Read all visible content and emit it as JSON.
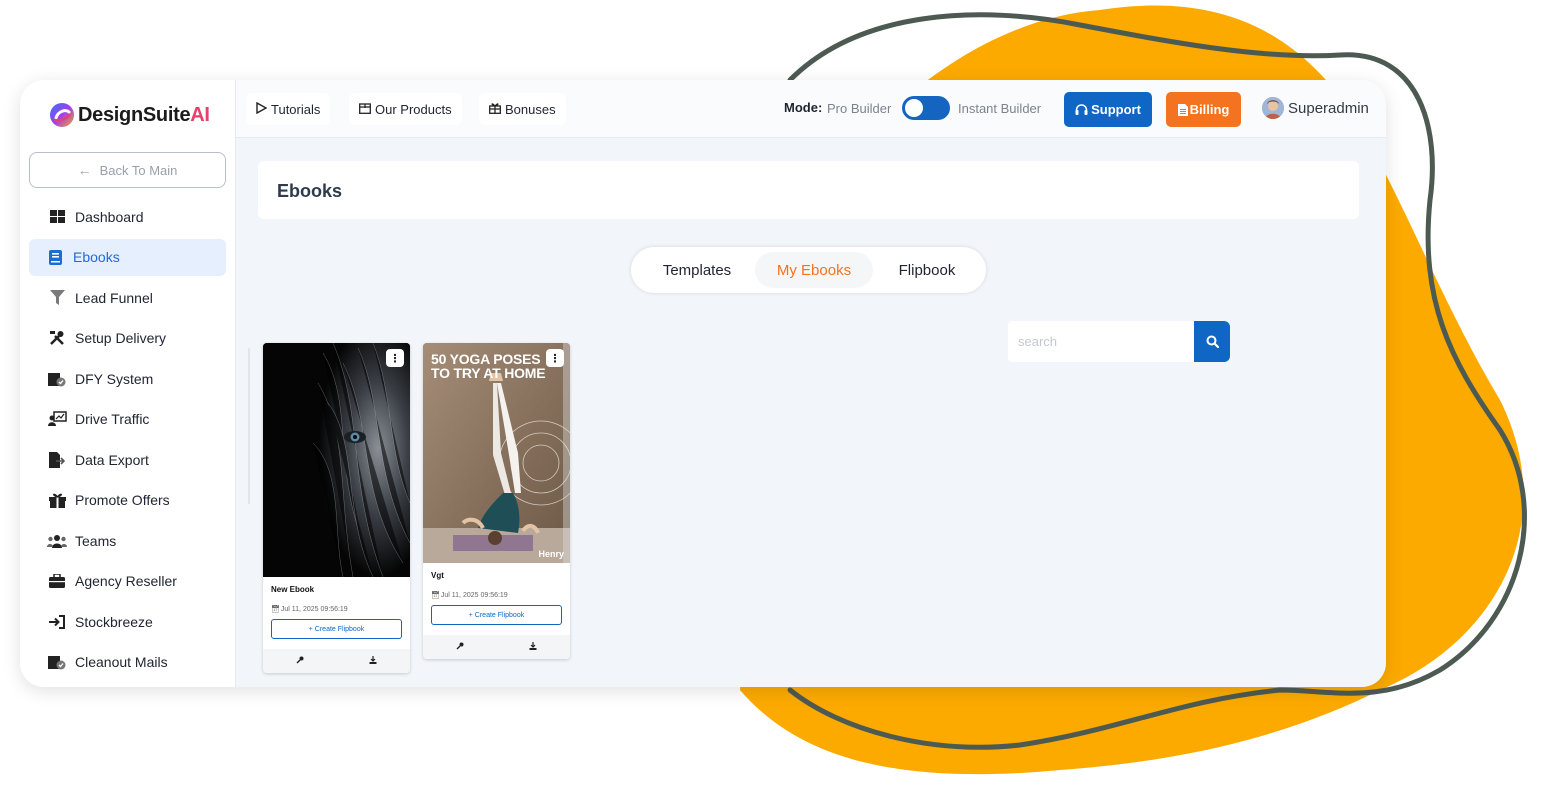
{
  "app": {
    "brand_main": "DesignSuite",
    "brand_accent": "AI",
    "back_label": "Back To Main"
  },
  "sidebar": {
    "items": [
      {
        "label": "Dashboard",
        "icon": "dashboard-icon"
      },
      {
        "label": "Ebooks",
        "icon": "book-icon",
        "active": true
      },
      {
        "label": "Lead Funnel",
        "icon": "funnel-icon"
      },
      {
        "label": "Setup Delivery",
        "icon": "tools-icon"
      },
      {
        "label": "DFY System",
        "icon": "box-check-icon"
      },
      {
        "label": "Drive Traffic",
        "icon": "traffic-icon"
      },
      {
        "label": "Data Export",
        "icon": "export-icon"
      },
      {
        "label": "Promote Offers",
        "icon": "gift-icon"
      },
      {
        "label": "Teams",
        "icon": "team-icon"
      },
      {
        "label": "Agency Reseller",
        "icon": "briefcase-icon"
      },
      {
        "label": "Stockbreeze",
        "icon": "sign-in-icon"
      },
      {
        "label": "Cleanout Mails",
        "icon": "box-check-icon"
      }
    ]
  },
  "topbar": {
    "tutorials": "Tutorials",
    "products": "Our Products",
    "bonuses": "Bonuses",
    "mode_label": "Mode:",
    "mode_pro": "Pro Builder",
    "mode_instant": "Instant Builder",
    "support": "Support",
    "billing": "Billing",
    "user": "Superadmin"
  },
  "page": {
    "title": "Ebooks",
    "tabs": [
      {
        "label": "Templates"
      },
      {
        "label": "My Ebooks",
        "active": true
      },
      {
        "label": "Flipbook"
      }
    ],
    "search_placeholder": "search"
  },
  "ebooks": [
    {
      "title": "New Ebook",
      "date": "Jul 11, 2025 09:56:19",
      "action": "+ Create Flipbook"
    },
    {
      "title": "Vgt",
      "date": "Jul 11, 2025 09:56:19",
      "action": "+ Create Flipbook",
      "cover_title": "50 YOGA POSES TO TRY AT HOME",
      "cover_author": "Henry"
    }
  ],
  "colors": {
    "primary": "#0f66c4",
    "accent": "#f47320",
    "blob": "#fcaa00",
    "active_bg": "#e6effd"
  }
}
